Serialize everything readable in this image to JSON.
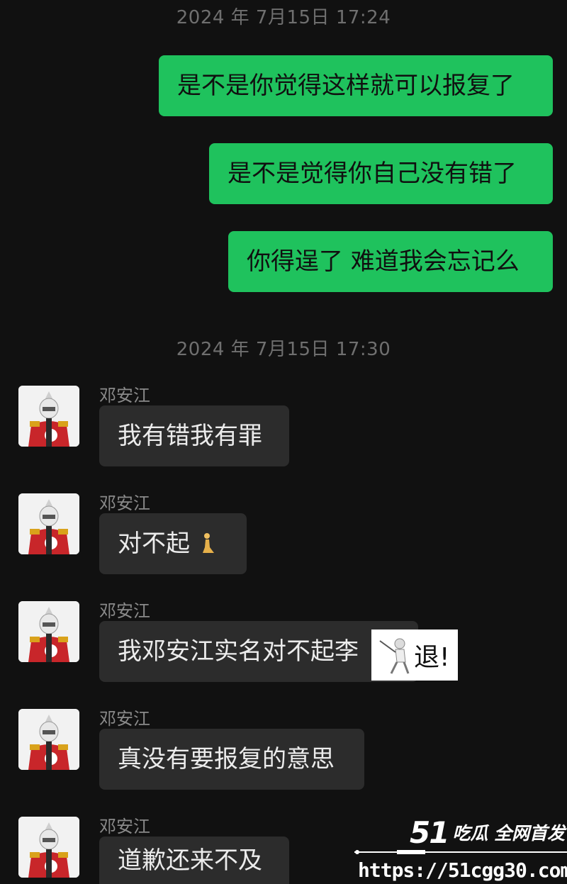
{
  "timestamps": [
    "2024 年 7月15日 17:24",
    "2024 年 7月15日 17:30"
  ],
  "outgoing": [
    "是不是你觉得这样就可以报复了",
    "是不是觉得你自己没有错了",
    "你得逞了 难道我会忘记么"
  ],
  "incoming": [
    {
      "sender": "邓安江",
      "text": "我有错我有罪"
    },
    {
      "sender": "邓安江",
      "text": "对不起"
    },
    {
      "sender": "邓安江",
      "text": "我邓安江实名对不起李"
    },
    {
      "sender": "邓安江",
      "text": "真没有要报复的意思"
    },
    {
      "sender": "邓安江",
      "text": "道歉还来不及"
    }
  ],
  "icons": {
    "avatar": "armored-character-avatar-icon",
    "kneel": "person-kneeling-emoji-icon",
    "fencer": "fencer-emoji-icon"
  },
  "sticker": {
    "text": "退!"
  },
  "watermark": {
    "brand_num": "51",
    "brand_text": "吃瓜 全网首发",
    "url": "https://51cgg30.com"
  },
  "colors": {
    "background": "#111111",
    "outgoing_bubble": "#1fc25d",
    "incoming_bubble": "#2c2c2c",
    "timestamp": "#6f6f6f",
    "sender_name": "#8a8a8a"
  }
}
